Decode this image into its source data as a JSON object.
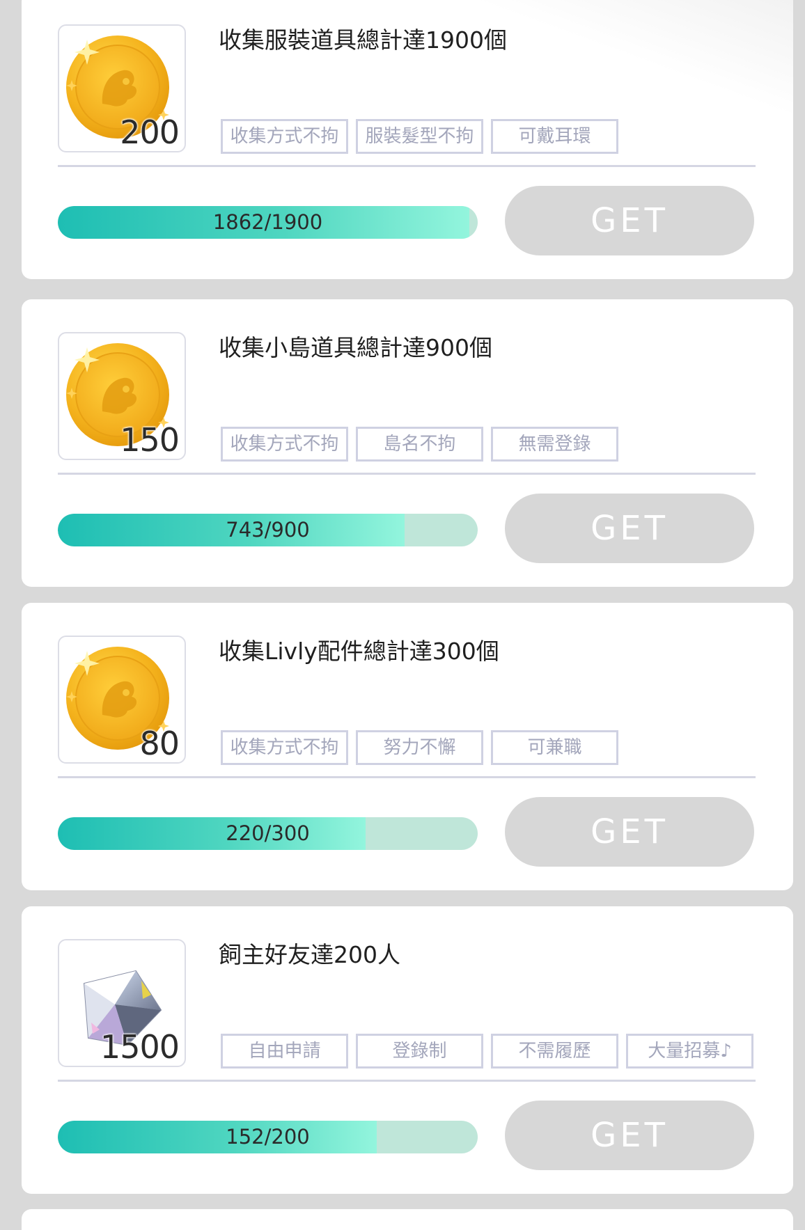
{
  "tasks": [
    {
      "title": "收集服裝道具總計達1900個",
      "reward_icon": "gold-coin-icon",
      "reward_amount": "200",
      "tags": [
        "收集方式不拘",
        "服裝髮型不拘",
        "可戴耳環"
      ],
      "progress_text": "1862/1900",
      "progress_current": 1862,
      "progress_total": 1900,
      "button_label": "GET"
    },
    {
      "title": "收集小島道具總計達900個",
      "reward_icon": "gold-coin-icon",
      "reward_amount": "150",
      "tags": [
        "收集方式不拘",
        "島名不拘",
        "無需登錄"
      ],
      "progress_text": "743/900",
      "progress_current": 743,
      "progress_total": 900,
      "button_label": "GET"
    },
    {
      "title": "收集Livly配件總計達300個",
      "reward_icon": "gold-coin-icon",
      "reward_amount": "80",
      "tags": [
        "收集方式不拘",
        "努力不懈",
        "可兼職"
      ],
      "progress_text": "220/300",
      "progress_current": 220,
      "progress_total": 300,
      "button_label": "GET"
    },
    {
      "title": "飼主好友達200人",
      "reward_icon": "diamond-icon",
      "reward_amount": "1500",
      "tags": [
        "自由申請",
        "登錄制",
        "不需履歷",
        "大量招募♪"
      ],
      "progress_text": "152/200",
      "progress_current": 152,
      "progress_total": 200,
      "button_label": "GET"
    }
  ],
  "colors": {
    "progress_fill_start": "#1ebeb3",
    "progress_fill_end": "#93f5dd",
    "progress_track": "#bfe6d9",
    "button_disabled": "#d7d7d7",
    "tag_border": "#cfd1e2",
    "tag_text": "#a3a6bb",
    "coin_gold": "#f5b41e",
    "background": "#d9d9d9"
  }
}
